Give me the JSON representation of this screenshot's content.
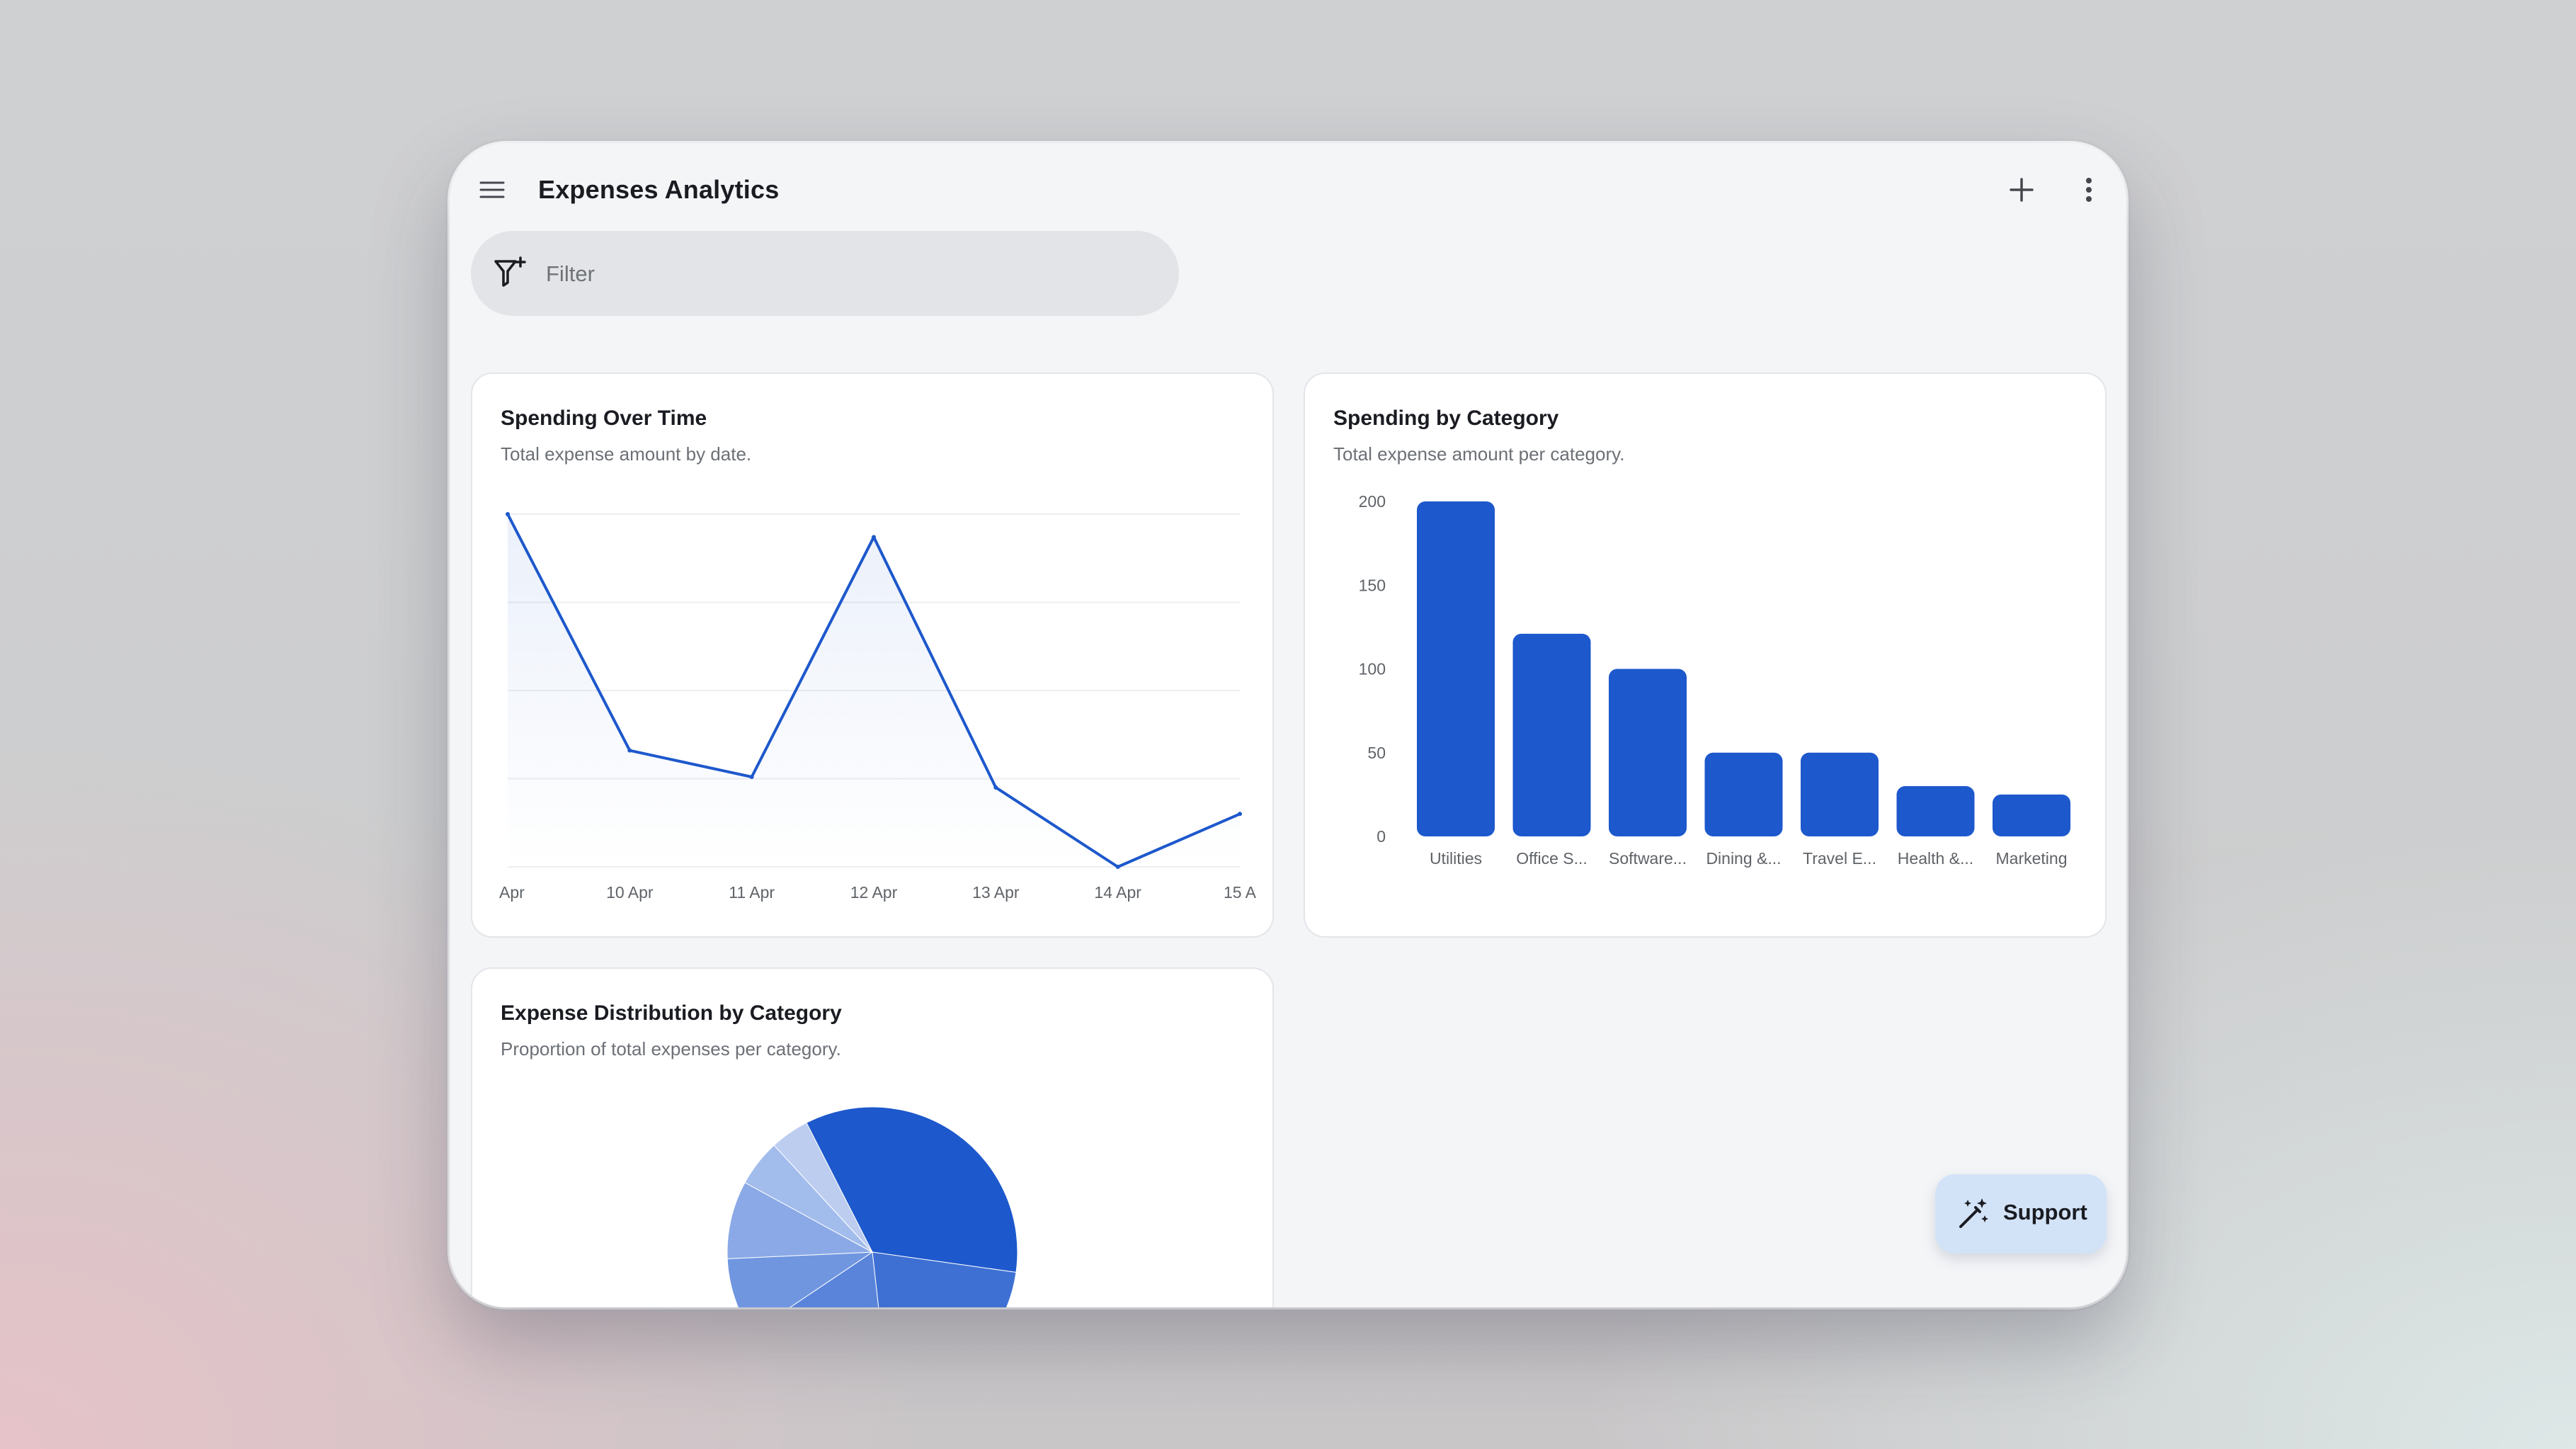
{
  "app": {
    "title": "Expenses Analytics"
  },
  "icons": {
    "menu": "hamburger-menu-icon",
    "add": "plus-icon",
    "more": "more-vertical-icon",
    "filter": "filter-plus-icon",
    "support": "magic-wand-icon"
  },
  "filter": {
    "placeholder": "Filter",
    "value": ""
  },
  "colors": {
    "accent": "#1d58cc",
    "background": "#f4f5f7",
    "card": "#ffffff"
  },
  "cards": {
    "spending_over_time": {
      "title": "Spending Over Time",
      "subtitle": "Total expense amount by date."
    },
    "spending_by_category": {
      "title": "Spending by Category",
      "subtitle": "Total expense amount per category."
    },
    "distribution": {
      "title": "Expense Distribution by Category",
      "subtitle": "Proportion of total expenses per category."
    }
  },
  "support": {
    "label": "Support"
  },
  "chart_data": [
    {
      "type": "line",
      "title": "Spending Over Time",
      "x": [
        "Apr",
        "10 Apr",
        "11 Apr",
        "12 Apr",
        "13 Apr",
        "14 Apr",
        "15 A"
      ],
      "x_tick_labels": [
        "Apr",
        "10 Apr",
        "11 Apr",
        "12 Apr",
        "13 Apr",
        "14 Apr",
        "15 A"
      ],
      "values": [
        200,
        66,
        51,
        187,
        45,
        0,
        30
      ],
      "ylim": [
        0,
        200
      ],
      "grid": true,
      "area_fill": true
    },
    {
      "type": "bar",
      "title": "Spending by Category",
      "categories": [
        "Utilities",
        "Office S...",
        "Software...",
        "Dining &...",
        "Travel E...",
        "Health &...",
        "Marketing"
      ],
      "values": [
        200,
        121,
        100,
        50,
        50,
        30,
        25
      ],
      "yticks": [
        0,
        50,
        100,
        150,
        200
      ],
      "ylim": [
        0,
        200
      ]
    },
    {
      "type": "pie",
      "title": "Expense Distribution by Category",
      "values": [
        200,
        121,
        100,
        50,
        50,
        30,
        25
      ],
      "colors": [
        "#1d58cc",
        "#3e70d4",
        "#5a84da",
        "#7096e0",
        "#8aa9e6",
        "#a2bcec",
        "#bccdf0"
      ]
    }
  ]
}
